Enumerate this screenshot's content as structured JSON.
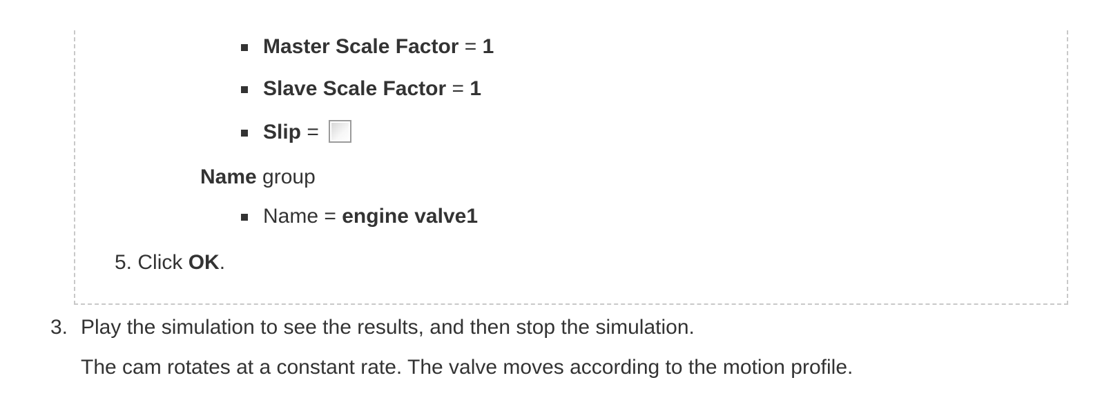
{
  "bullets": {
    "master_scale": {
      "label": "Master Scale Factor",
      "eq": " = ",
      "value": "1"
    },
    "slave_scale": {
      "label": "Slave Scale Factor",
      "eq": " = ",
      "value": "1"
    },
    "slip": {
      "label": "Slip",
      "eq": " = "
    },
    "name_field": {
      "label": "Name",
      "eq": " = ",
      "value": "engine valve1"
    }
  },
  "name_group": {
    "title": "Name",
    "suffix": " group"
  },
  "step5": {
    "number": "5.",
    "text": " Click ",
    "button": "OK",
    "end": "."
  },
  "step3": {
    "number": "3.",
    "text": "Play the simulation to see the results, and then stop the simulation.",
    "note": "The cam rotates at a constant rate. The valve moves according to the motion profile."
  }
}
